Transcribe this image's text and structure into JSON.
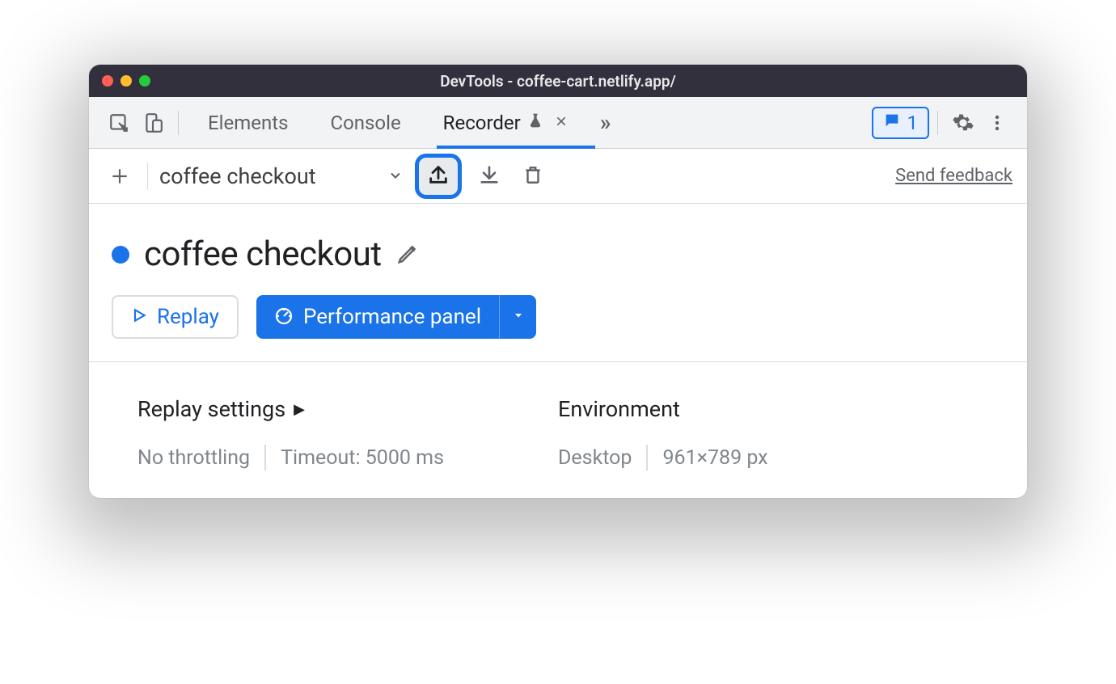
{
  "titlebar": {
    "title": "DevTools - coffee-cart.netlify.app/",
    "traffic_colors": {
      "close": "#ff5f56",
      "minimize": "#ffbd2e",
      "zoom": "#27c93f"
    }
  },
  "tabs": {
    "items": [
      {
        "label": "Elements",
        "active": false
      },
      {
        "label": "Console",
        "active": false
      },
      {
        "label": "Recorder",
        "active": true,
        "experimental": true,
        "closable": true
      }
    ],
    "overflow_icon": "»",
    "messages_count": "1"
  },
  "recorder_toolbar": {
    "selected_recording": "coffee checkout",
    "feedback_link": "Send feedback"
  },
  "recording": {
    "title": "coffee checkout",
    "replay_label": "Replay",
    "performance_panel_label": "Performance panel"
  },
  "replay_settings": {
    "heading": "Replay settings",
    "throttling": "No throttling",
    "timeout": "Timeout: 5000 ms"
  },
  "environment": {
    "heading": "Environment",
    "device": "Desktop",
    "viewport": "961×789 px"
  }
}
